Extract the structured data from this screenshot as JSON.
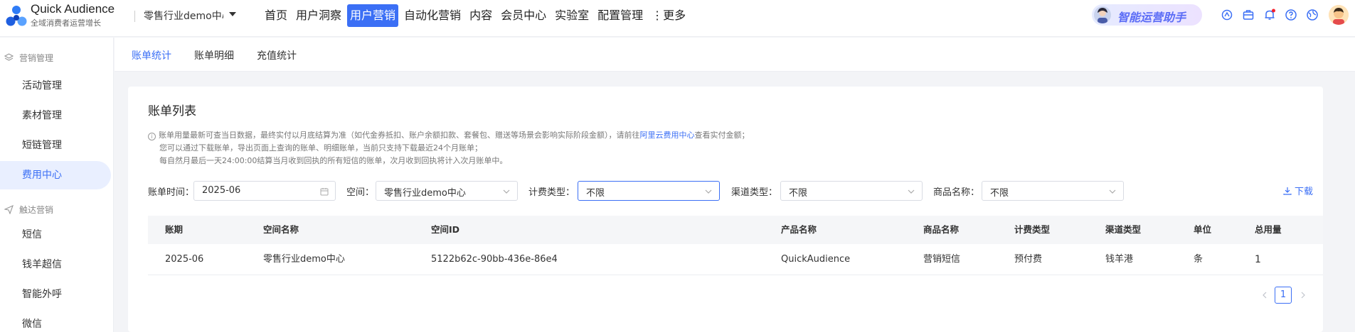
{
  "header": {
    "brand_title": "Quick Audience",
    "brand_subtitle": "全域消费者运营增长",
    "workspace": "零售行业demo中心",
    "nav": [
      {
        "label": "首页",
        "active": false
      },
      {
        "label": "用户洞察",
        "active": false
      },
      {
        "label": "用户营销",
        "active": true
      },
      {
        "label": "自动化营销",
        "active": false
      },
      {
        "label": "内容",
        "active": false
      },
      {
        "label": "会员中心",
        "active": false
      },
      {
        "label": "实验室",
        "active": false
      },
      {
        "label": "配置管理",
        "active": false
      },
      {
        "label": "⋮更多",
        "active": false
      }
    ],
    "assistant_label": "智能运营助手",
    "icons": [
      "ai-icon",
      "briefcase-icon",
      "bell-icon",
      "help-icon",
      "globe-icon"
    ]
  },
  "sidebar": {
    "group1": "营销管理",
    "group1_items": [
      "活动管理",
      "素材管理",
      "短链管理",
      "费用中心"
    ],
    "group2": "触达营销",
    "group2_items": [
      "短信",
      "钱羊超信",
      "智能外呼",
      "微信"
    ],
    "active_item": "费用中心"
  },
  "subtabs": [
    {
      "label": "账单统计",
      "active": true
    },
    {
      "label": "账单明细",
      "active": false
    },
    {
      "label": "充值统计",
      "active": false
    }
  ],
  "card": {
    "title": "账单列表",
    "notice": {
      "line1_pre": "账单用量最新可查当日数据，最终实付以月底结算为准（如代金券抵扣、账户余额扣款、套餐包、赠送等场景会影响实际阶段金额），请前往",
      "line1_link": "阿里云费用中心",
      "line1_post": "查看实付金额；",
      "line2": "您可以通过下载账单，导出页面上查询的账单、明细账单，当前只支持下载最近24个月账单；",
      "line3": "每自然月最后一天24:00:00结算当月收到回执的所有短信的账单，次月收到回执将计入次月账单中。"
    },
    "filters": {
      "bill_time_label": "账单时间：",
      "bill_time_value": "2025-06",
      "space_label": "空间：",
      "space_value": "零售行业demo中心",
      "billing_type_label": "计费类型：",
      "billing_type_value": "不限",
      "channel_type_label": "渠道类型：",
      "channel_type_value": "不限",
      "product_name_label": "商品名称：",
      "product_name_value": "不限"
    },
    "download_label": "下载",
    "table": {
      "columns": [
        "账期",
        "空间名称",
        "空间ID",
        "产品名称",
        "商品名称",
        "计费类型",
        "渠道类型",
        "单位",
        "总用量"
      ],
      "rows": [
        [
          "2025-06",
          "零售行业demo中心",
          "5122b62c-90bb-436e-86e4",
          "QuickAudience",
          "营销短信",
          "预付费",
          "钱羊港",
          "条",
          "1"
        ]
      ]
    },
    "pagination": {
      "current": "1"
    }
  }
}
